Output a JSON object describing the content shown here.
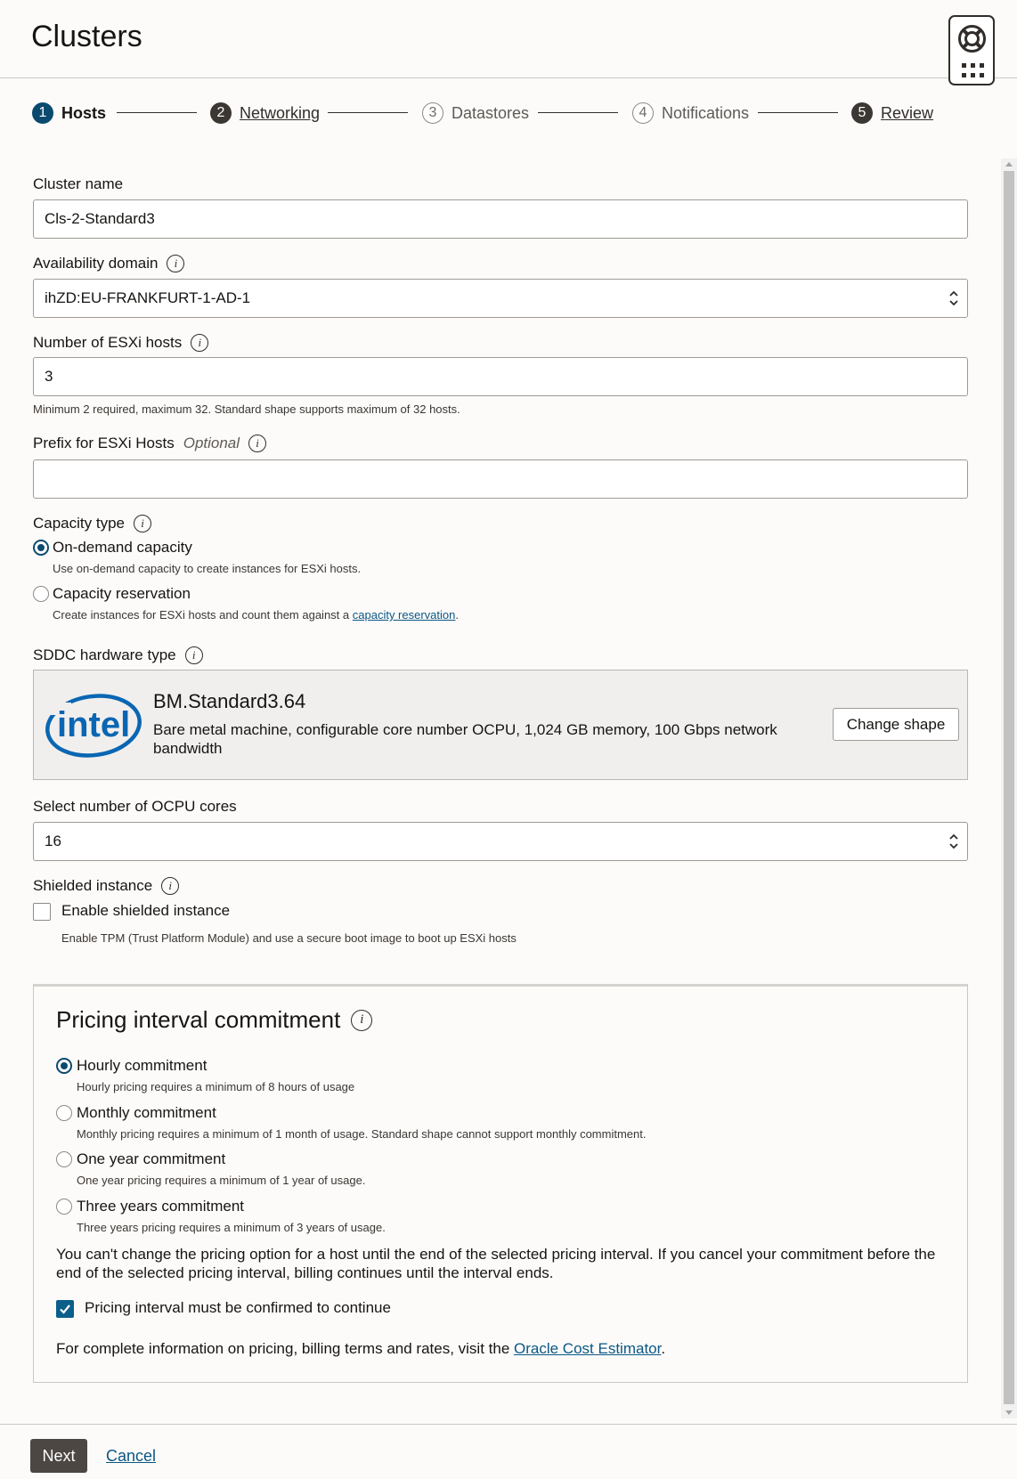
{
  "page": {
    "title": "Clusters"
  },
  "stepper": [
    {
      "num": "1",
      "label": "Hosts",
      "state": "current"
    },
    {
      "num": "2",
      "label": "Networking",
      "state": "link"
    },
    {
      "num": "3",
      "label": "Datastores",
      "state": "disabled"
    },
    {
      "num": "4",
      "label": "Notifications",
      "state": "disabled"
    },
    {
      "num": "5",
      "label": "Review",
      "state": "link"
    }
  ],
  "form": {
    "cluster_name": {
      "label": "Cluster name",
      "value": "Cls-2-Standard3"
    },
    "availability_domain": {
      "label": "Availability domain",
      "value": "ihZD:EU-FRANKFURT-1-AD-1"
    },
    "esxi_hosts": {
      "label": "Number of ESXi hosts",
      "value": "3",
      "help": "Minimum 2 required, maximum 32. Standard shape supports maximum of 32 hosts."
    },
    "prefix": {
      "label": "Prefix for ESXi Hosts",
      "optional": "Optional",
      "value": ""
    },
    "capacity_type": {
      "label": "Capacity type",
      "options": [
        {
          "label": "On-demand capacity",
          "help": "Use on-demand capacity to create instances for ESXi hosts.",
          "selected": true
        },
        {
          "label": "Capacity reservation",
          "help_prefix": "Create instances for ESXi hosts and count them against a ",
          "help_link": "capacity reservation",
          "help_suffix": ".",
          "selected": false
        }
      ]
    },
    "hardware_type": {
      "label": "SDDC hardware type",
      "shape_name": "BM.Standard3.64",
      "shape_desc": "Bare metal machine, configurable core number OCPU, 1,024 GB memory, 100 Gbps network bandwidth",
      "change_button": "Change shape",
      "logo_text": "intel"
    },
    "ocpu_cores": {
      "label": "Select number of OCPU cores",
      "value": "16"
    },
    "shielded": {
      "label": "Shielded instance",
      "checkbox_label": "Enable shielded instance",
      "checked": false,
      "help": "Enable TPM (Trust Platform Module) and use a secure boot image to boot up ESXi hosts"
    }
  },
  "pricing": {
    "title": "Pricing interval commitment",
    "options": [
      {
        "label": "Hourly commitment",
        "help": "Hourly pricing requires a minimum of 8 hours of usage",
        "selected": true
      },
      {
        "label": "Monthly commitment",
        "help": "Monthly pricing requires a minimum of 1 month of usage. Standard shape cannot support monthly commitment.",
        "selected": false
      },
      {
        "label": "One year commitment",
        "help": "One year pricing requires a minimum of 1 year of usage.",
        "selected": false
      },
      {
        "label": "Three years commitment",
        "help": "Three years pricing requires a minimum of 3 years of usage.",
        "selected": false
      }
    ],
    "warning": "You can't change the pricing option for a host until the end of the selected pricing interval. If you cancel your commitment before the end of the selected pricing interval, billing continues until the interval ends.",
    "confirm_label": "Pricing interval must be confirmed to continue",
    "confirm_checked": true,
    "info_prefix": "For complete information on pricing, billing terms and rates, visit the ",
    "info_link": "Oracle Cost Estimator",
    "info_suffix": "."
  },
  "footer": {
    "next_label": "Next",
    "cancel_label": "Cancel"
  },
  "colors": {
    "accent": "#0b4a6f",
    "link": "#0b5784",
    "primary_button": "#4c4743"
  }
}
